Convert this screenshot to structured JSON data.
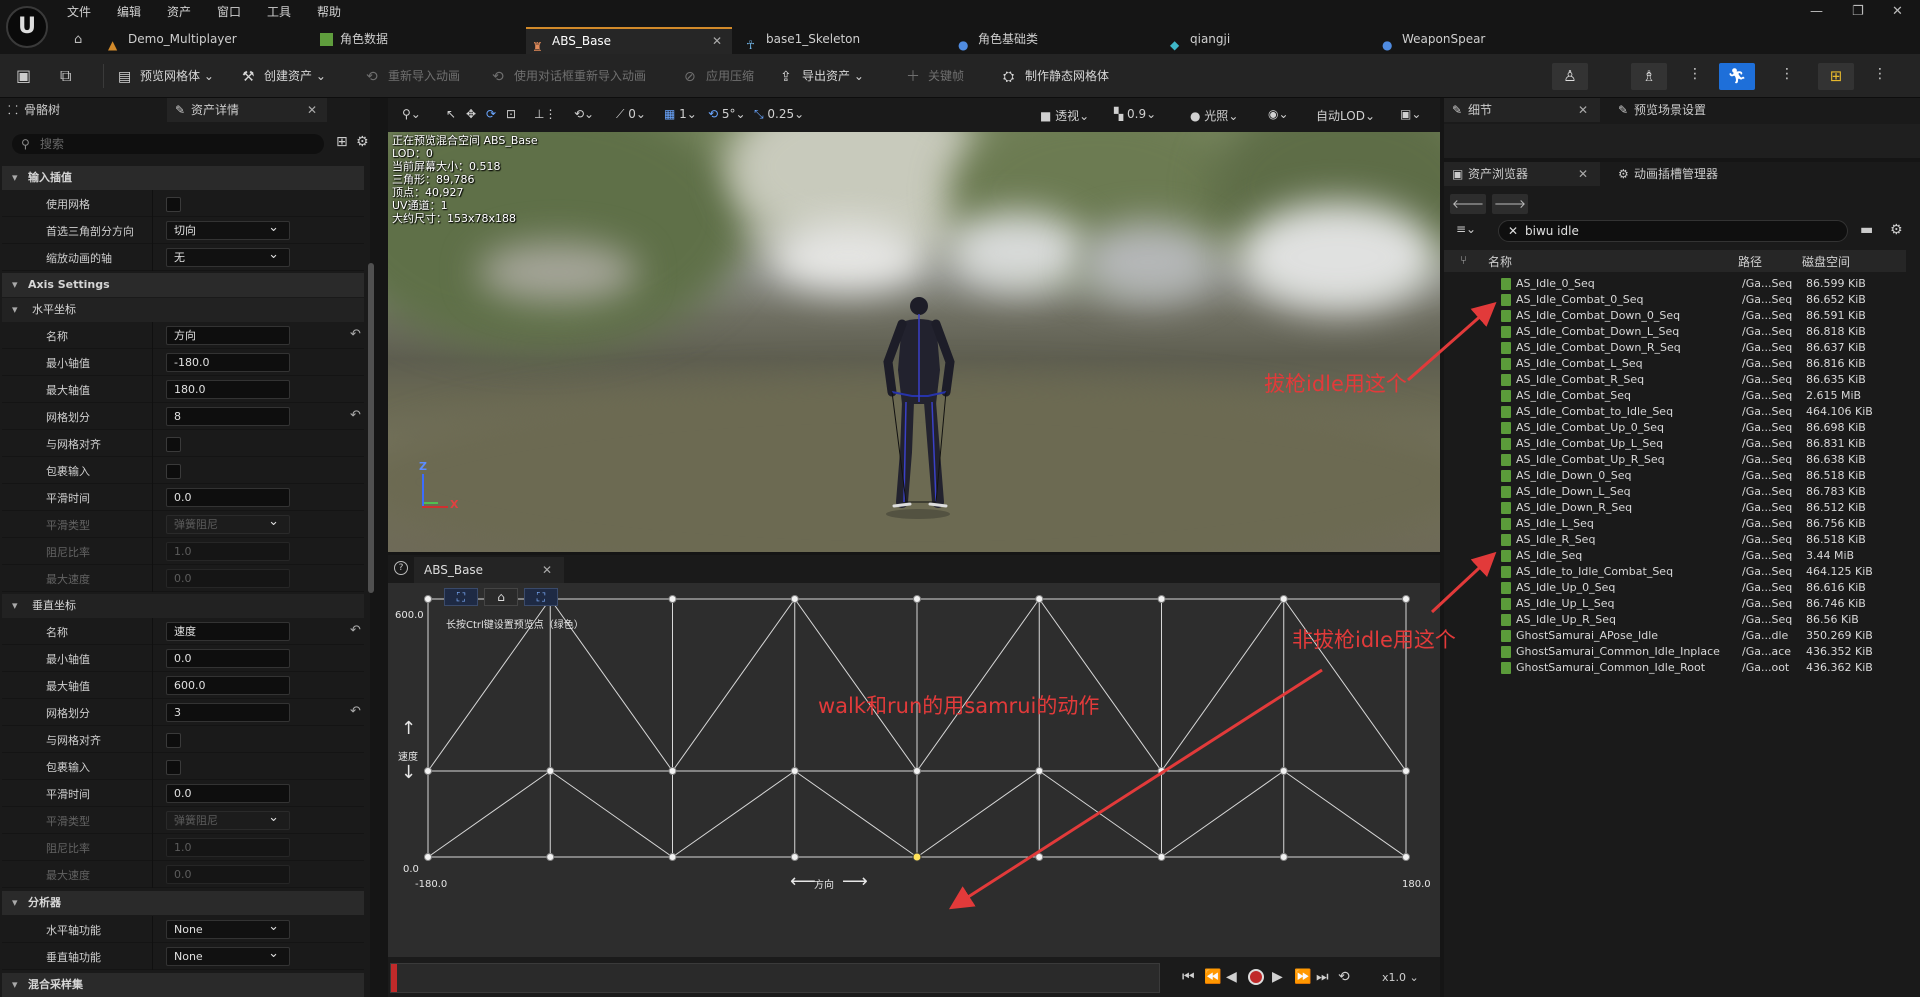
{
  "menu": [
    "文件",
    "编辑",
    "资产",
    "窗口",
    "工具",
    "帮助"
  ],
  "logo": "U",
  "doc_tabs": [
    {
      "label": "Demo_Multiplayer"
    },
    {
      "label": "角色数据"
    },
    {
      "label": "ABS_Base",
      "active": true
    },
    {
      "label": "base1_Skeleton"
    },
    {
      "label": "角色基础类"
    },
    {
      "label": "qiangji"
    },
    {
      "label": "WeaponSpear"
    }
  ],
  "toolbar": {
    "preview_mesh": "预览网格体",
    "create_asset": "创建资产",
    "reimport": "重新导入动画",
    "reimport_new": "使用对话框重新导入动画",
    "apply_compression": "应用压缩",
    "export_asset": "导出资产",
    "keyframe": "关键帧",
    "make_static_mesh": "制作静态网格体"
  },
  "left_panel": {
    "tab_skeleton": "骨骼树",
    "tab_details": "资产详情",
    "search_placeholder": "搜索",
    "cat_input": "输入插值",
    "use_grid": "使用网格",
    "preferred_tri": "首选三角剖分方向",
    "preferred_tri_value": "切向",
    "scale_axis": "缩放动画的轴",
    "scale_axis_value": "无",
    "cat_axis": "Axis Settings",
    "h_axis": "水平坐标",
    "name": "名称",
    "h_name_value": "方向",
    "min": "最小轴值",
    "h_min": "-180.0",
    "max": "最大轴值",
    "h_max": "180.0",
    "divisions": "网格划分",
    "h_div": "8",
    "snap": "与网格对齐",
    "wrap": "包裹输入",
    "smooth_time": "平滑时间",
    "h_smooth": "0.0",
    "smooth_type": "平滑类型",
    "smooth_type_value": "弹簧阻尼",
    "damping": "阻尼比率",
    "h_damp": "1.0",
    "max_speed": "最大速度",
    "h_speed": "0.0",
    "v_axis": "垂直坐标",
    "v_name_value": "速度",
    "v_min": "0.0",
    "v_max": "600.0",
    "v_div": "3",
    "v_smooth": "0.0",
    "v_damp": "1.0",
    "v_speed": "0.0",
    "cat_analysis": "分析器",
    "h_func": "水平轴功能",
    "h_func_value": "None",
    "v_func": "垂直轴功能",
    "v_func_value": "None",
    "cat_samples": "混合采样集"
  },
  "viewport": {
    "toolbar": {
      "perspective": "透视",
      "lit": "光照",
      "lod": "自动LOD",
      "snap_val1": "0",
      "snap_val2": "1",
      "snap_val3": "5°",
      "snap_val4": "0.25",
      "fov": "0.9"
    },
    "stats": [
      "正在预览混合空间 ABS_Base",
      "LOD：0",
      "当前屏幕大小：0.518",
      "三角形：89,786",
      "顶点：40,927",
      "UV通道：1",
      "大约尺寸：153x78x188"
    ],
    "axis_z": "Z",
    "axis_x": "X"
  },
  "blend_space": {
    "tab": "ABS_Base",
    "y_max": "600.0",
    "y_min": "0.0",
    "x_min": "-180.0",
    "x_max": "180.0",
    "x_label": "方向",
    "y_label": "速度",
    "hint": "长按Ctrl键设置预览点（绿色）",
    "speed": "x1.0"
  },
  "right": {
    "details_tab": "细节",
    "preview_scene_tab": "预览场景设置",
    "cb_tab": "资产浏览器",
    "anim_slot_tab": "动画插槽管理器",
    "search_value": "biwu idle",
    "col_name": "名称",
    "col_path": "路径",
    "col_size": "磁盘空间",
    "assets": [
      {
        "name": "AS_Idle_0_Seq",
        "path": "/Ga...Seq",
        "size": "86.599 KiB"
      },
      {
        "name": "AS_Idle_Combat_0_Seq",
        "path": "/Ga...Seq",
        "size": "86.652 KiB"
      },
      {
        "name": "AS_Idle_Combat_Down_0_Seq",
        "path": "/Ga...Seq",
        "size": "86.591 KiB"
      },
      {
        "name": "AS_Idle_Combat_Down_L_Seq",
        "path": "/Ga...Seq",
        "size": "86.818 KiB"
      },
      {
        "name": "AS_Idle_Combat_Down_R_Seq",
        "path": "/Ga...Seq",
        "size": "86.637 KiB"
      },
      {
        "name": "AS_Idle_Combat_L_Seq",
        "path": "/Ga...Seq",
        "size": "86.816 KiB"
      },
      {
        "name": "AS_Idle_Combat_R_Seq",
        "path": "/Ga...Seq",
        "size": "86.635 KiB"
      },
      {
        "name": "AS_Idle_Combat_Seq",
        "path": "/Ga...Seq",
        "size": "2.615 MiB"
      },
      {
        "name": "AS_Idle_Combat_to_Idle_Seq",
        "path": "/Ga...Seq",
        "size": "464.106 KiB"
      },
      {
        "name": "AS_Idle_Combat_Up_0_Seq",
        "path": "/Ga...Seq",
        "size": "86.698 KiB"
      },
      {
        "name": "AS_Idle_Combat_Up_L_Seq",
        "path": "/Ga...Seq",
        "size": "86.831 KiB"
      },
      {
        "name": "AS_Idle_Combat_Up_R_Seq",
        "path": "/Ga...Seq",
        "size": "86.638 KiB"
      },
      {
        "name": "AS_Idle_Down_0_Seq",
        "path": "/Ga...Seq",
        "size": "86.518 KiB"
      },
      {
        "name": "AS_Idle_Down_L_Seq",
        "path": "/Ga...Seq",
        "size": "86.783 KiB"
      },
      {
        "name": "AS_Idle_Down_R_Seq",
        "path": "/Ga...Seq",
        "size": "86.512 KiB"
      },
      {
        "name": "AS_Idle_L_Seq",
        "path": "/Ga...Seq",
        "size": "86.756 KiB"
      },
      {
        "name": "AS_Idle_R_Seq",
        "path": "/Ga...Seq",
        "size": "86.518 KiB"
      },
      {
        "name": "AS_Idle_Seq",
        "path": "/Ga...Seq",
        "size": "3.44 MiB"
      },
      {
        "name": "AS_Idle_to_Idle_Combat_Seq",
        "path": "/Ga...Seq",
        "size": "464.125 KiB"
      },
      {
        "name": "AS_Idle_Up_0_Seq",
        "path": "/Ga...Seq",
        "size": "86.616 KiB"
      },
      {
        "name": "AS_Idle_Up_L_Seq",
        "path": "/Ga...Seq",
        "size": "86.746 KiB"
      },
      {
        "name": "AS_Idle_Up_R_Seq",
        "path": "/Ga...Seq",
        "size": "86.56 KiB"
      },
      {
        "name": "GhostSamurai_APose_Idle",
        "path": "/Ga...dle",
        "size": "350.269 KiB"
      },
      {
        "name": "GhostSamurai_Common_Idle_Inplace",
        "path": "/Ga...ace",
        "size": "436.352 KiB"
      },
      {
        "name": "GhostSamurai_Common_Idle_Root",
        "path": "/Ga...oot",
        "size": "436.362 KiB"
      }
    ]
  },
  "annotations": {
    "combat_idle": "拔枪idle用这个",
    "normal_idle": "非拔枪idle用这个",
    "walk_run": "walk和run的用samrui的动作",
    "color": "#e23a3a"
  }
}
